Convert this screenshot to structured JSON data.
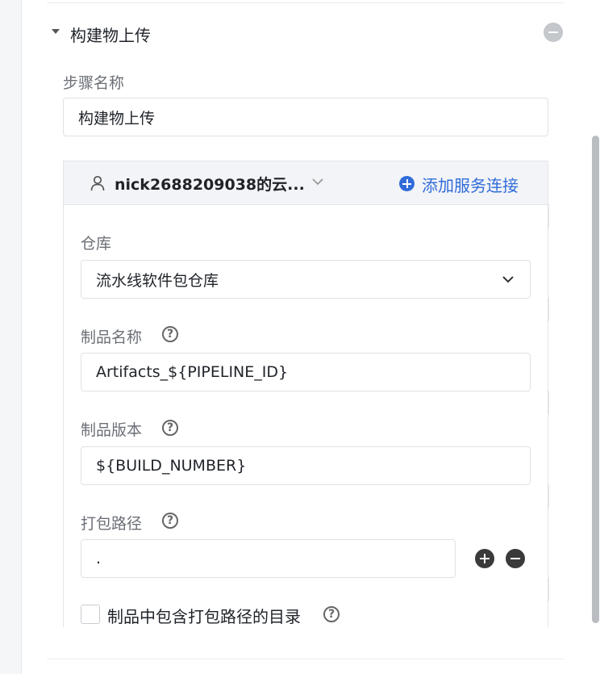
{
  "section": {
    "title": "构建物上传"
  },
  "step_name": {
    "label": "步骤名称",
    "value": "构建物上传"
  },
  "service": {
    "account": "nick2688209038的云...",
    "add_connection_label": "添加服务连接"
  },
  "repository": {
    "label": "仓库",
    "selected": "流水线软件包仓库"
  },
  "artifact_name": {
    "label": "制品名称",
    "value": "Artifacts_${PIPELINE_ID}"
  },
  "artifact_version": {
    "label": "制品版本",
    "value": "${BUILD_NUMBER}"
  },
  "pack_path": {
    "label": "打包路径",
    "value": "."
  },
  "include_dir": {
    "label": "制品中包含打包路径的目录",
    "checked": false
  },
  "help_glyph": "?",
  "colors": {
    "accent": "#2f6bd9",
    "border": "#dfe1e5",
    "header_bg": "#f2f4f7"
  }
}
